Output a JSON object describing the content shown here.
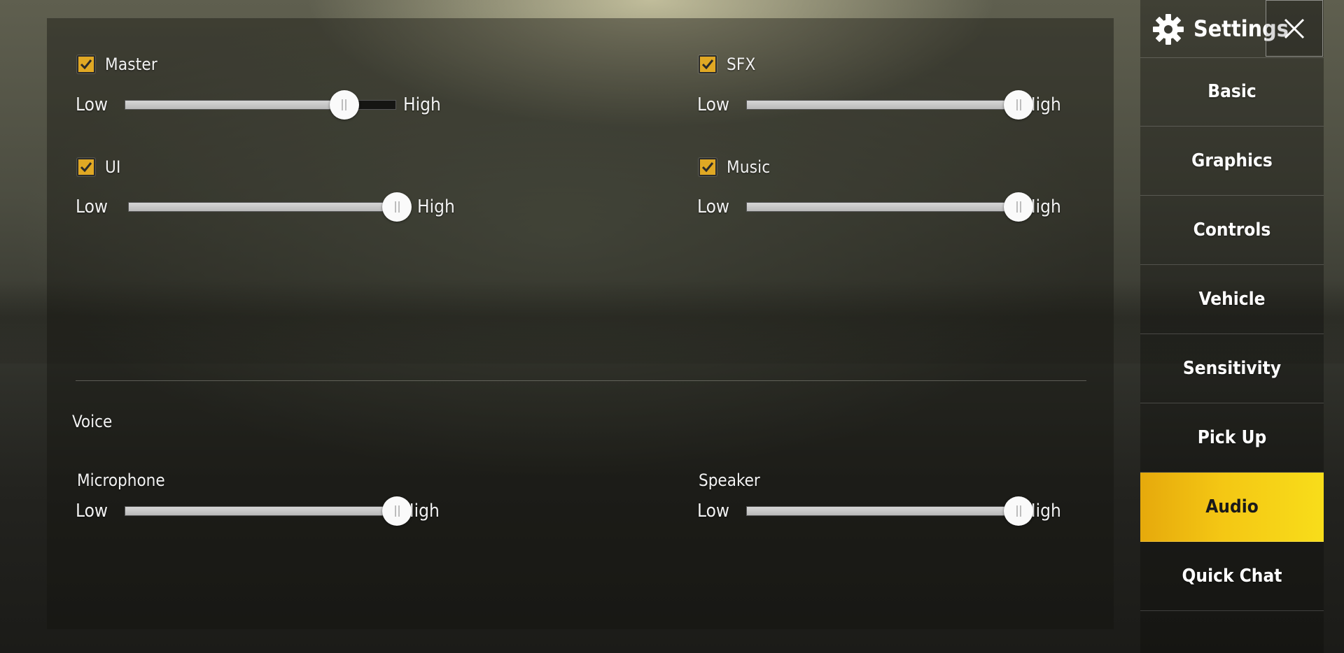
{
  "audio": {
    "master": {
      "label": "Master",
      "checked": true,
      "level": 0.81
    },
    "sfx": {
      "label": "SFX",
      "checked": true,
      "level": 1.0
    },
    "ui": {
      "label": "UI",
      "checked": true,
      "level": 1.0
    },
    "music": {
      "label": "Music",
      "checked": true,
      "level": 1.0
    },
    "low_label": "Low",
    "high_label": "High"
  },
  "voice": {
    "title": "Voice",
    "microphone": {
      "label": "Microphone",
      "level": 1.0
    },
    "speaker": {
      "label": "Speaker",
      "level": 1.0
    }
  },
  "sidebar": {
    "title": "Settings",
    "items": [
      {
        "label": "Basic"
      },
      {
        "label": "Graphics"
      },
      {
        "label": "Controls"
      },
      {
        "label": "Vehicle"
      },
      {
        "label": "Sensitivity"
      },
      {
        "label": "Pick Up"
      },
      {
        "label": "Audio",
        "active": true
      },
      {
        "label": "Quick Chat"
      }
    ]
  },
  "colors": {
    "accent": "#f4c714",
    "checkbox": "#e0a824"
  },
  "icons": {
    "settings": "gear-icon",
    "close": "close-icon",
    "checkbox": "checkmark-icon"
  }
}
